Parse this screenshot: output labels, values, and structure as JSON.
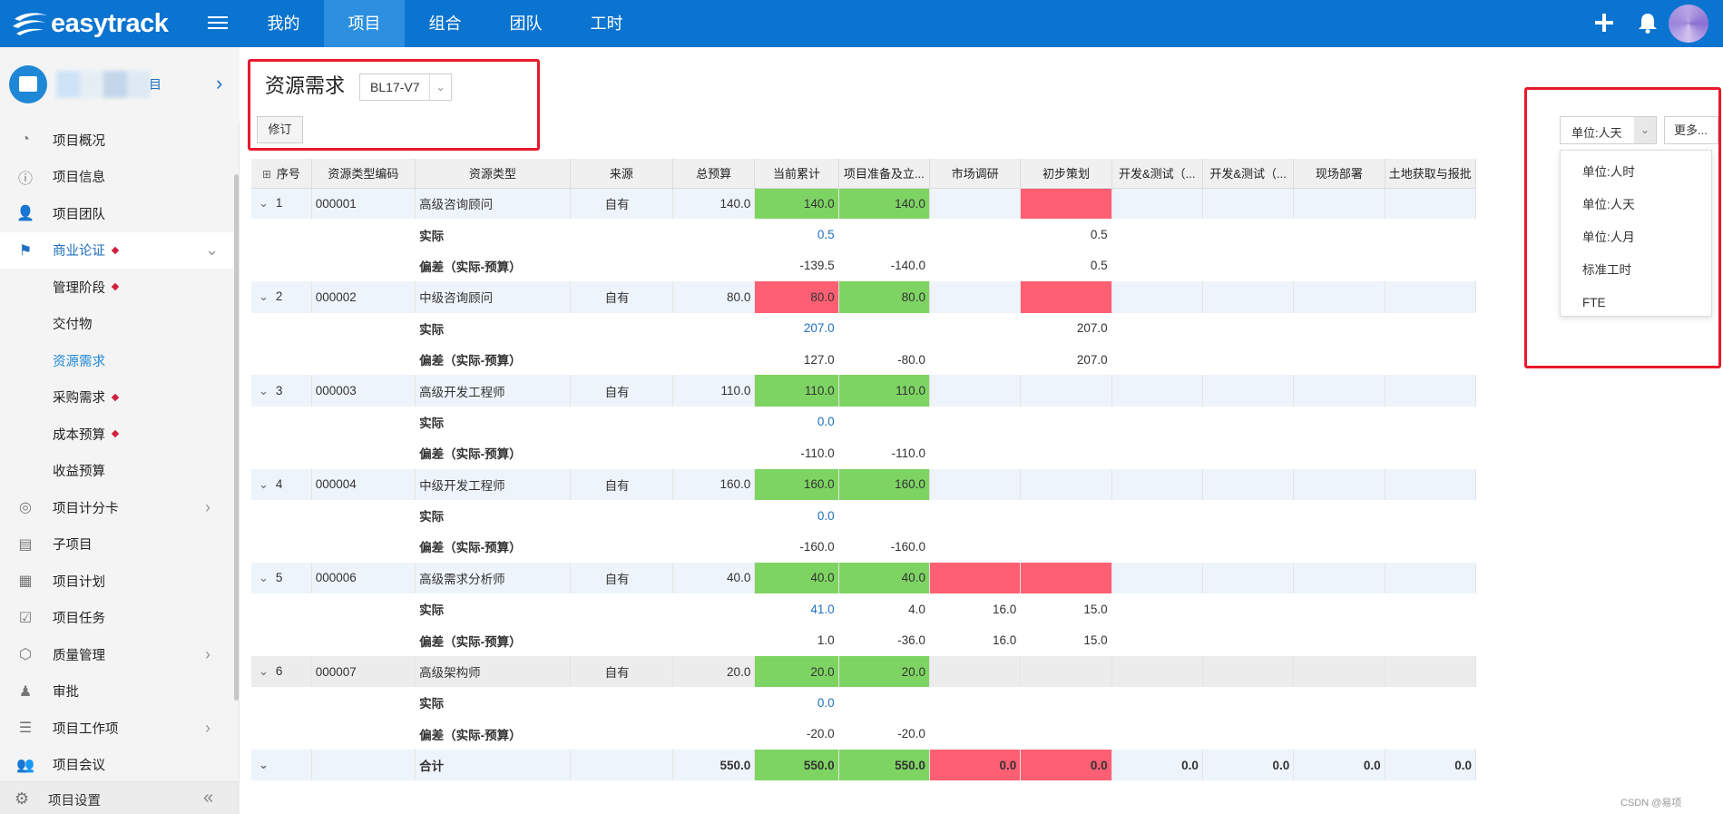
{
  "app": {
    "logo_text": "easytrack"
  },
  "nav": {
    "items": [
      "我的",
      "项目",
      "组合",
      "团队",
      "工时"
    ],
    "active_index": 1
  },
  "project": {
    "name_suffix": "目"
  },
  "sidebar": {
    "items": [
      {
        "label": "项目概况",
        "icon": "pie-chart-icon"
      },
      {
        "label": "项目信息",
        "icon": "info-icon"
      },
      {
        "label": "项目团队",
        "icon": "team-icon"
      },
      {
        "label": "商业论证",
        "icon": "flag-icon",
        "marked": true,
        "expanded": true
      },
      {
        "label": "管理阶段",
        "sub": true,
        "marked": true
      },
      {
        "label": "交付物",
        "sub": true
      },
      {
        "label": "资源需求",
        "sub": true,
        "current": true
      },
      {
        "label": "采购需求",
        "sub": true,
        "marked": true
      },
      {
        "label": "成本预算",
        "sub": true,
        "marked": true
      },
      {
        "label": "收益预算",
        "sub": true
      },
      {
        "label": "项目计分卡",
        "icon": "scorecard-icon"
      },
      {
        "label": "子项目",
        "icon": "subproject-icon"
      },
      {
        "label": "项目计划",
        "icon": "plan-icon"
      },
      {
        "label": "项目任务",
        "icon": "task-icon"
      },
      {
        "label": "质量管理",
        "icon": "quality-icon"
      },
      {
        "label": "审批",
        "icon": "approval-icon"
      },
      {
        "label": "项目工作项",
        "icon": "workitem-icon"
      },
      {
        "label": "项目会议",
        "icon": "meeting-icon"
      }
    ],
    "footer_label": "项目设置"
  },
  "page": {
    "title": "资源需求",
    "version": "BL17-V7",
    "revise_button": "修订",
    "unit_select": "单位:人天",
    "more_button": "更多...",
    "unit_options": [
      "单位:人时",
      "单位:人天",
      "单位:人月",
      "标准工时",
      "FTE"
    ]
  },
  "table": {
    "headers": [
      "序号",
      "资源类型编码",
      "资源类型",
      "来源",
      "总预算",
      "当前累计",
      "项目准备及立...",
      "市场调研",
      "初步策划",
      "开发&测试（...",
      "开发&测试（...",
      "现场部署",
      "土地获取与报批"
    ],
    "label_actual": "实际",
    "label_variance": "偏差（实际-预算）",
    "rows": [
      {
        "no": "1",
        "code": "000001",
        "type": "高级咨询顾问",
        "source": "自有",
        "budget": "140.0",
        "current": "140.0",
        "prep": "140.0",
        "survey": "",
        "plan": "",
        "actual_current": "0.5",
        "actual_prep": "",
        "actual_survey": "",
        "actual_plan": "0.5",
        "var_current": "-139.5",
        "var_prep": "-140.0",
        "var_survey": "",
        "var_plan": "0.5",
        "cur_color": "g",
        "prep_color": "g",
        "survey_color": "",
        "plan_color": "r",
        "gray": false
      },
      {
        "no": "2",
        "code": "000002",
        "type": "中级咨询顾问",
        "source": "自有",
        "budget": "80.0",
        "current": "80.0",
        "prep": "80.0",
        "survey": "",
        "plan": "",
        "actual_current": "207.0",
        "actual_prep": "",
        "actual_survey": "",
        "actual_plan": "207.0",
        "var_current": "127.0",
        "var_prep": "-80.0",
        "var_survey": "",
        "var_plan": "207.0",
        "cur_color": "r",
        "prep_color": "g",
        "survey_color": "",
        "plan_color": "r",
        "gray": false
      },
      {
        "no": "3",
        "code": "000003",
        "type": "高级开发工程师",
        "source": "自有",
        "budget": "110.0",
        "current": "110.0",
        "prep": "110.0",
        "survey": "",
        "plan": "",
        "actual_current": "0.0",
        "actual_prep": "",
        "actual_survey": "",
        "actual_plan": "",
        "var_current": "-110.0",
        "var_prep": "-110.0",
        "var_survey": "",
        "var_plan": "",
        "cur_color": "g",
        "prep_color": "g",
        "survey_color": "",
        "plan_color": "",
        "gray": false
      },
      {
        "no": "4",
        "code": "000004",
        "type": "中级开发工程师",
        "source": "自有",
        "budget": "160.0",
        "current": "160.0",
        "prep": "160.0",
        "survey": "",
        "plan": "",
        "actual_current": "0.0",
        "actual_prep": "",
        "actual_survey": "",
        "actual_plan": "",
        "var_current": "-160.0",
        "var_prep": "-160.0",
        "var_survey": "",
        "var_plan": "",
        "cur_color": "g",
        "prep_color": "g",
        "survey_color": "",
        "plan_color": "",
        "gray": false
      },
      {
        "no": "5",
        "code": "000006",
        "type": "高级需求分析师",
        "source": "自有",
        "budget": "40.0",
        "current": "40.0",
        "prep": "40.0",
        "survey": "",
        "plan": "",
        "actual_current": "41.0",
        "actual_prep": "4.0",
        "actual_survey": "16.0",
        "actual_plan": "15.0",
        "var_current": "1.0",
        "var_prep": "-36.0",
        "var_survey": "16.0",
        "var_plan": "15.0",
        "cur_color": "g",
        "prep_color": "g",
        "survey_color": "r",
        "plan_color": "r",
        "gray": false
      },
      {
        "no": "6",
        "code": "000007",
        "type": "高级架构师",
        "source": "自有",
        "budget": "20.0",
        "current": "20.0",
        "prep": "20.0",
        "survey": "",
        "plan": "",
        "actual_current": "0.0",
        "actual_prep": "",
        "actual_survey": "",
        "actual_plan": "",
        "var_current": "-20.0",
        "var_prep": "-20.0",
        "var_survey": "",
        "var_plan": "",
        "cur_color": "g",
        "prep_color": "g",
        "survey_color": "",
        "plan_color": "",
        "gray": true
      }
    ],
    "total": {
      "label": "合计",
      "values": [
        "550.0",
        "550.0",
        "550.0",
        "0.0",
        "0.0",
        "0.0",
        "0.0",
        "0.0",
        "0.0"
      ]
    }
  },
  "watermark": "CSDN @易项"
}
